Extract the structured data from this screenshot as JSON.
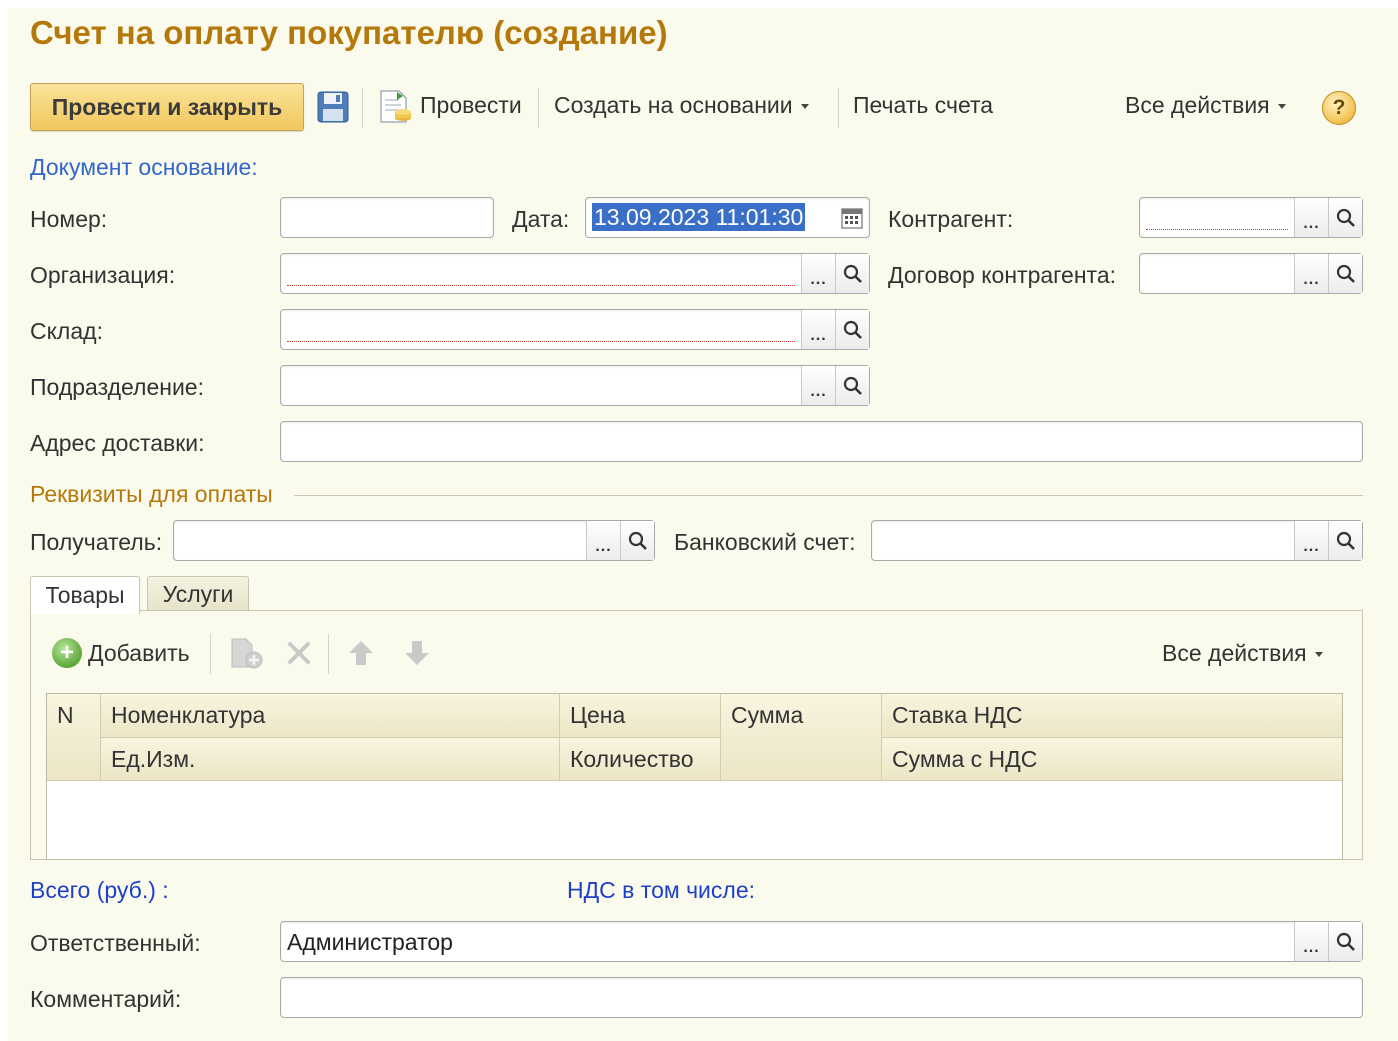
{
  "window": {
    "title": "Счет на оплату покупателю (создание)"
  },
  "toolbar": {
    "post_and_close": "Провести и закрыть",
    "save_icon": "save-icon",
    "post": "Провести",
    "create_based_on": "Создать на основании",
    "print_invoice": "Печать счета",
    "all_actions": "Все действия",
    "help": "?"
  },
  "header": {
    "base_document_link": "Документ основание:",
    "number_label": "Номер:",
    "number_value": "",
    "date_label": "Дата:",
    "date_value": "13.09.2023 11:01:30",
    "contractor_label": "Контрагент:",
    "contractor_value": "",
    "organization_label": "Организация:",
    "organization_value": "",
    "contract_label": "Договор контрагента:",
    "contract_value": "",
    "warehouse_label": "Склад:",
    "warehouse_value": "",
    "department_label": "Подразделение:",
    "department_value": "",
    "delivery_address_label": "Адрес доставки:",
    "delivery_address_value": ""
  },
  "payment": {
    "section_title": "Реквизиты для оплаты",
    "recipient_label": "Получатель:",
    "recipient_value": "",
    "bank_account_label": "Банковский счет:",
    "bank_account_value": ""
  },
  "tabs": [
    {
      "label": "Товары",
      "active": true
    },
    {
      "label": "Услуги",
      "active": false
    }
  ],
  "table_toolbar": {
    "add": "Добавить",
    "all_actions": "Все действия"
  },
  "table": {
    "col_n": "N",
    "col_nomenclature": "Номенклатура",
    "col_unit": "Ед.Изм.",
    "col_price": "Цена",
    "col_quantity": "Количество",
    "col_sum": "Сумма",
    "col_vat_rate": "Ставка НДС",
    "col_sum_with_vat": "Сумма с НДС",
    "rows": []
  },
  "totals": {
    "total_label": "Всего (руб.) :",
    "vat_label": "НДС в том числе:"
  },
  "footer": {
    "responsible_label": "Ответственный:",
    "responsible_value": "Администратор",
    "comment_label": "Комментарий:",
    "comment_value": ""
  },
  "colors": {
    "title": "#b5780a",
    "link": "#3366cc",
    "total_labels": "#1f3fc8",
    "form_background": "#fbfbed",
    "primary_button": "#f1c75c",
    "selection": "#3a6fc8"
  }
}
